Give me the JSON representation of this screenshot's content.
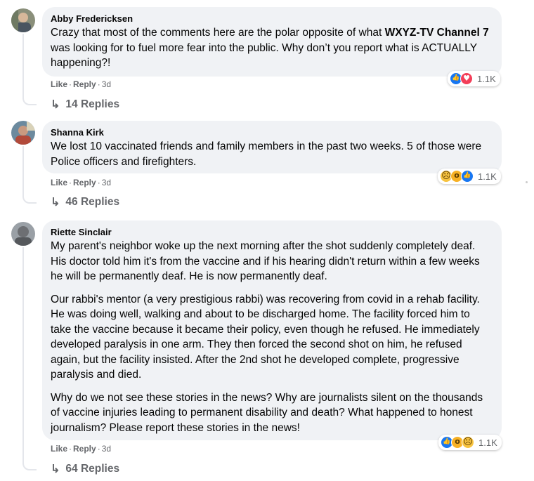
{
  "comments": [
    {
      "author": "Abby Fredericksen",
      "text_before": "Crazy that most of the comments here are the polar opposite of what ",
      "text_bold": "WXYZ-TV Channel 7",
      "text_after": " was looking for to fuel more fear into the public. Why don’t you report what is ACTUALLY happening?!",
      "reactions": [
        "like",
        "love"
      ],
      "reaction_count": "1.1K",
      "like_label": "Like",
      "reply_label": "Reply",
      "time": "3d",
      "replies_label": "14 Replies"
    },
    {
      "author": "Shanna Kirk",
      "text": "We lost 10 vaccinated friends and family members in the past two weeks. 5 of those were Police officers and firefighters.",
      "reactions": [
        "sad",
        "wow",
        "like"
      ],
      "reaction_count": "1.1K",
      "like_label": "Like",
      "reply_label": "Reply",
      "time": "3d",
      "replies_label": "46 Replies"
    },
    {
      "author": "Riette Sinclair",
      "paragraphs": [
        "My parent's neighbor woke up the next morning after the shot suddenly completely deaf. His doctor told him it's from the vaccine and if his hearing didn't return within a few weeks he will be permanently deaf. He is now permanently deaf.",
        "Our rabbi's mentor (a very prestigious rabbi) was recovering from covid in a rehab facility. He was doing well, walking and about to be discharged home. The facility forced him to take the vaccine because it became their policy, even though he refused. He immediately developed paralysis in one arm. They then forced the second shot on him, he refused again, but the facility insisted. After the 2nd shot he developed complete, progressive paralysis and died.",
        "Why do we not see these stories in the news? Why are journalists silent on the thousands of vaccine injuries leading to permanent disability and death? What happened to honest journalism? Please report these stories in the news!"
      ],
      "reactions": [
        "like",
        "wow",
        "sad"
      ],
      "reaction_count": "1.1K",
      "like_label": "Like",
      "reply_label": "Reply",
      "time": "3d",
      "replies_label": "64 Replies"
    }
  ],
  "colors": {
    "bubble": "#f0f2f5",
    "secondary_text": "#65676b",
    "like_blue": "#1877f2",
    "love_red": "#f33e58"
  }
}
